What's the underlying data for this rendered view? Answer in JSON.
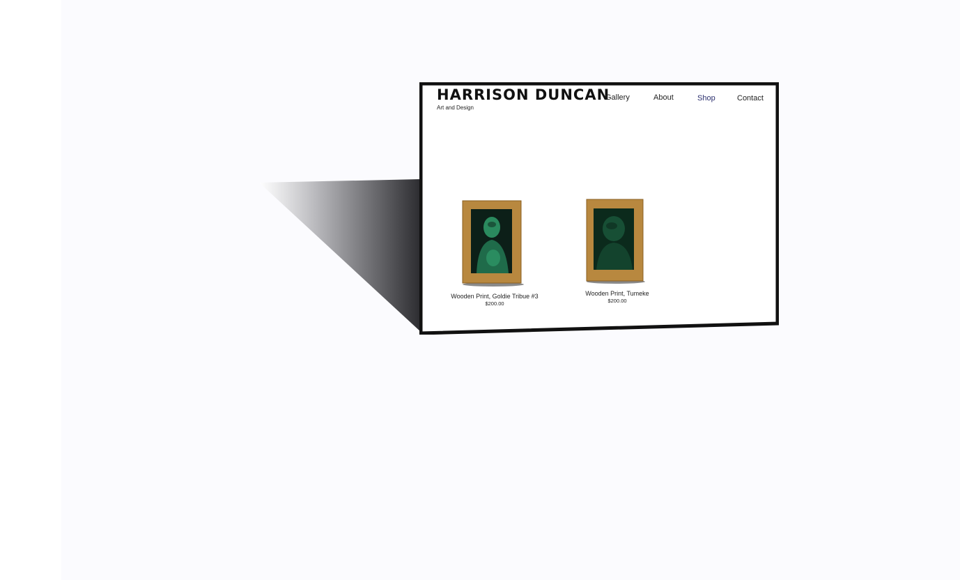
{
  "site": {
    "title": "HARRISON DUNCAN",
    "subtitle": "Art and Design"
  },
  "nav": {
    "items": [
      {
        "label": "Gallery",
        "active": false
      },
      {
        "label": "About",
        "active": false
      },
      {
        "label": "Shop",
        "active": true
      },
      {
        "label": "Contact",
        "active": false
      }
    ],
    "active_color": "#2b2f6e"
  },
  "products": [
    {
      "name": "Wooden Print, Goldie Tribue #3",
      "price": "$200.00"
    },
    {
      "name": "Wooden Print, Tumeke",
      "price": "$200.00"
    }
  ],
  "colors": {
    "wood": "#b8883f",
    "print_green": "#1f6b4a",
    "frame_border": "#111111"
  }
}
